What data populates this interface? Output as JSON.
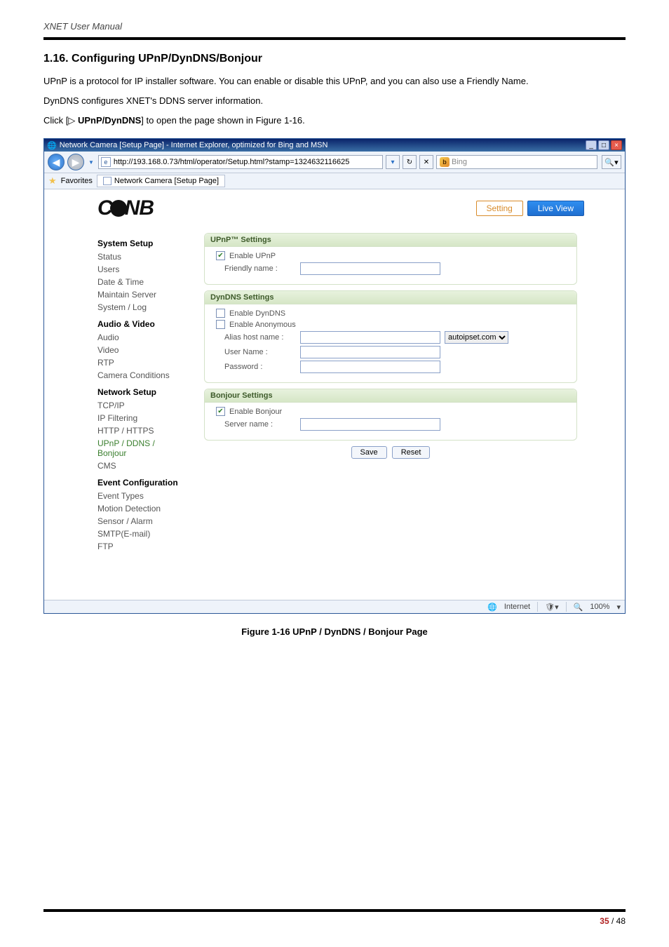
{
  "doc": {
    "header": "XNET User Manual",
    "section_heading": "1.16. Configuring UPnP/DynDNS/Bonjour",
    "para1": "UPnP is a protocol for IP installer software. You can enable or disable this UPnP, and you can also use a Friendly Name.",
    "para2": "DynDNS configures XNET's DDNS server information.",
    "para3_pre": "Click [▷ ",
    "para3_bold": "UPnP/DynDNS",
    "para3_post": "] to open the page shown in Figure 1-16.",
    "figure_caption": "Figure 1-16 UPnP / DynDNS / Bonjour Page",
    "page_current": "35",
    "page_sep": " / ",
    "page_total": "48"
  },
  "ie": {
    "title": "Network Camera [Setup Page] - Internet Explorer, optimized for Bing and MSN",
    "url": "http://193.168.0.73/html/operator/Setup.html?stamp=1324632116625",
    "search_placeholder": "Bing",
    "fav_label": "Favorites",
    "tab_label": "Network Camera [Setup Page]",
    "status_zone": "Internet",
    "status_zoom": "100%"
  },
  "ui": {
    "btn_setting": "Setting",
    "btn_live": "Live View",
    "sidebar": {
      "g1": "System Setup",
      "g1_items": [
        "Status",
        "Users",
        "Date & Time",
        "Maintain Server",
        "System / Log"
      ],
      "g2": "Audio & Video",
      "g2_items": [
        "Audio",
        "Video",
        "RTP",
        "Camera Conditions"
      ],
      "g3": "Network Setup",
      "g3_items": [
        "TCP/IP",
        "IP Filtering",
        "HTTP / HTTPS",
        "UPnP / DDNS / Bonjour",
        "CMS"
      ],
      "g4": "Event Configuration",
      "g4_items": [
        "Event Types",
        "Motion Detection",
        "Sensor / Alarm",
        "SMTP(E-mail)",
        "FTP"
      ]
    },
    "panel": {
      "upnp_title": "UPnP™ Settings",
      "upnp_enable": "Enable UPnP",
      "upnp_friendly": "Friendly name :",
      "dyn_title": "DynDNS Settings",
      "dyn_enable": "Enable DynDNS",
      "dyn_anon": "Enable Anonymous",
      "dyn_alias": "Alias host name :",
      "dyn_domain": "autoipset.com",
      "dyn_user": "User Name :",
      "dyn_pass": "Password :",
      "bon_title": "Bonjour Settings",
      "bon_enable": "Enable Bonjour",
      "bon_server": "Server name :",
      "btn_save": "Save",
      "btn_reset": "Reset"
    }
  }
}
